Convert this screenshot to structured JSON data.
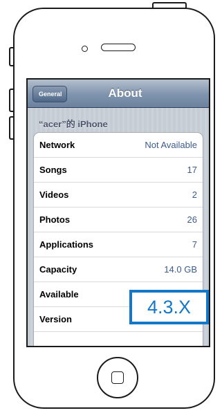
{
  "nav": {
    "back_label": "General",
    "title": "About"
  },
  "section_header": "“acer”的 iPhone",
  "rows": [
    {
      "label": "Network",
      "value": "Not Available"
    },
    {
      "label": "Songs",
      "value": "17"
    },
    {
      "label": "Videos",
      "value": "2"
    },
    {
      "label": "Photos",
      "value": "26"
    },
    {
      "label": "Applications",
      "value": "7"
    },
    {
      "label": "Capacity",
      "value": "14.0 GB"
    },
    {
      "label": "Available",
      "value": ""
    },
    {
      "label": "Version",
      "value": ""
    },
    {
      "label": "",
      "value": ""
    }
  ],
  "callout": {
    "text": "4.3.X",
    "color": "#1478c8"
  },
  "colors": {
    "nav_gradient_top": "#b4bfcd",
    "nav_gradient_bottom": "#6d829e",
    "value_blue": "#3b5a8a"
  }
}
